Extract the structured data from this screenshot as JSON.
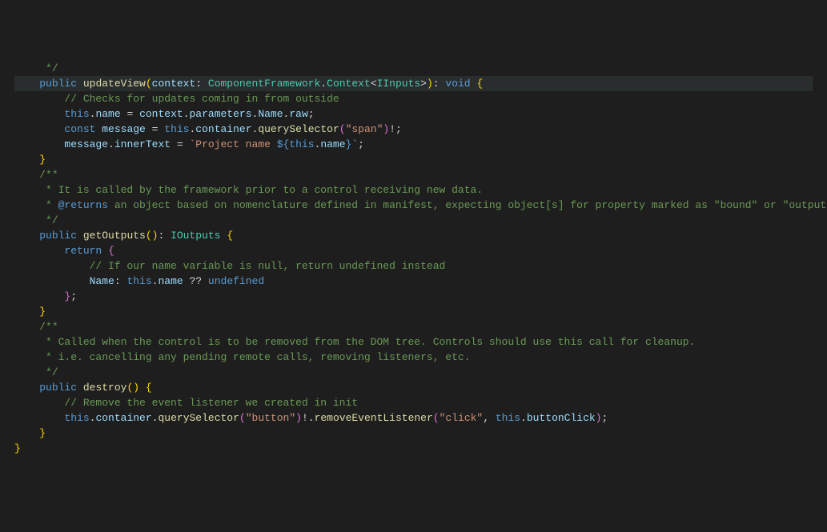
{
  "chart_data": null,
  "code": {
    "lines": [
      {
        "indent": 1,
        "tokens": [
          {
            "t": " ",
            "c": "pun"
          },
          {
            "t": "*/",
            "c": "cmt"
          }
        ]
      },
      {
        "indent": 1,
        "hl": true,
        "tokens": [
          {
            "t": "public",
            "c": "kw"
          },
          {
            "t": " ",
            "c": "pun"
          },
          {
            "t": "updateView",
            "c": "fn"
          },
          {
            "t": "(",
            "c": "brc-y"
          },
          {
            "t": "context",
            "c": "var"
          },
          {
            "t": ": ",
            "c": "pun"
          },
          {
            "t": "ComponentFramework",
            "c": "typ"
          },
          {
            "t": ".",
            "c": "pun"
          },
          {
            "t": "Context",
            "c": "typ"
          },
          {
            "t": "<",
            "c": "pun"
          },
          {
            "t": "IInputs",
            "c": "typ"
          },
          {
            "t": ">",
            "c": "pun"
          },
          {
            "t": ")",
            "c": "brc-y"
          },
          {
            "t": ": ",
            "c": "pun"
          },
          {
            "t": "void",
            "c": "kw"
          },
          {
            "t": " ",
            "c": "pun"
          },
          {
            "t": "{",
            "c": "brc-y"
          }
        ]
      },
      {
        "indent": 2,
        "tokens": [
          {
            "t": "// Checks for updates coming in from outside",
            "c": "cmt"
          }
        ]
      },
      {
        "indent": 2,
        "tokens": [
          {
            "t": "this",
            "c": "kw"
          },
          {
            "t": ".",
            "c": "pun"
          },
          {
            "t": "name",
            "c": "prop"
          },
          {
            "t": " = ",
            "c": "pun"
          },
          {
            "t": "context",
            "c": "var"
          },
          {
            "t": ".",
            "c": "pun"
          },
          {
            "t": "parameters",
            "c": "prop"
          },
          {
            "t": ".",
            "c": "pun"
          },
          {
            "t": "Name",
            "c": "prop"
          },
          {
            "t": ".",
            "c": "pun"
          },
          {
            "t": "raw",
            "c": "prop"
          },
          {
            "t": ";",
            "c": "pun"
          }
        ]
      },
      {
        "indent": 2,
        "tokens": [
          {
            "t": "const",
            "c": "kw"
          },
          {
            "t": " ",
            "c": "pun"
          },
          {
            "t": "message",
            "c": "var"
          },
          {
            "t": " = ",
            "c": "pun"
          },
          {
            "t": "this",
            "c": "kw"
          },
          {
            "t": ".",
            "c": "pun"
          },
          {
            "t": "container",
            "c": "prop"
          },
          {
            "t": ".",
            "c": "pun"
          },
          {
            "t": "querySelector",
            "c": "fn"
          },
          {
            "t": "(",
            "c": "brc-p"
          },
          {
            "t": "\"span\"",
            "c": "str"
          },
          {
            "t": ")",
            "c": "brc-p"
          },
          {
            "t": "!;",
            "c": "pun"
          }
        ]
      },
      {
        "indent": 2,
        "tokens": [
          {
            "t": "message",
            "c": "var"
          },
          {
            "t": ".",
            "c": "pun"
          },
          {
            "t": "innerText",
            "c": "prop"
          },
          {
            "t": " = ",
            "c": "pun"
          },
          {
            "t": "`Project name ",
            "c": "str"
          },
          {
            "t": "${",
            "c": "kw"
          },
          {
            "t": "this",
            "c": "kw"
          },
          {
            "t": ".",
            "c": "pun"
          },
          {
            "t": "name",
            "c": "prop"
          },
          {
            "t": "}",
            "c": "kw"
          },
          {
            "t": "`",
            "c": "str"
          },
          {
            "t": ";",
            "c": "pun"
          }
        ]
      },
      {
        "indent": 1,
        "tokens": [
          {
            "t": "}",
            "c": "brc-y"
          }
        ]
      },
      {
        "indent": 0,
        "tokens": [
          {
            "t": "",
            "c": "pun"
          }
        ]
      },
      {
        "indent": 1,
        "tokens": [
          {
            "t": "/**",
            "c": "cmt"
          }
        ]
      },
      {
        "indent": 1,
        "tokens": [
          {
            "t": " * It is called by the framework prior to a control receiving new data.",
            "c": "cmt"
          }
        ]
      },
      {
        "indent": 1,
        "tokens": [
          {
            "t": " * ",
            "c": "cmt"
          },
          {
            "t": "@returns",
            "c": "tag"
          },
          {
            "t": " an object based on nomenclature defined in manifest, expecting object[s] for property marked as \"bound\" or \"output\"",
            "c": "cmt"
          }
        ]
      },
      {
        "indent": 1,
        "tokens": [
          {
            "t": " */",
            "c": "cmt"
          }
        ]
      },
      {
        "indent": 1,
        "tokens": [
          {
            "t": "public",
            "c": "kw"
          },
          {
            "t": " ",
            "c": "pun"
          },
          {
            "t": "getOutputs",
            "c": "fn"
          },
          {
            "t": "()",
            "c": "brc-y"
          },
          {
            "t": ": ",
            "c": "pun"
          },
          {
            "t": "IOutputs",
            "c": "typ"
          },
          {
            "t": " ",
            "c": "pun"
          },
          {
            "t": "{",
            "c": "brc-y"
          }
        ]
      },
      {
        "indent": 2,
        "tokens": [
          {
            "t": "return",
            "c": "kw"
          },
          {
            "t": " ",
            "c": "pun"
          },
          {
            "t": "{",
            "c": "brc-p"
          }
        ]
      },
      {
        "indent": 3,
        "tokens": [
          {
            "t": "// If our name variable is null, return undefined instead",
            "c": "cmt"
          }
        ]
      },
      {
        "indent": 3,
        "tokens": [
          {
            "t": "Name",
            "c": "prop"
          },
          {
            "t": ": ",
            "c": "pun"
          },
          {
            "t": "this",
            "c": "kw"
          },
          {
            "t": ".",
            "c": "pun"
          },
          {
            "t": "name",
            "c": "prop"
          },
          {
            "t": " ?? ",
            "c": "pun"
          },
          {
            "t": "undefined",
            "c": "kw"
          }
        ]
      },
      {
        "indent": 2,
        "tokens": [
          {
            "t": "}",
            "c": "brc-p"
          },
          {
            "t": ";",
            "c": "pun"
          }
        ]
      },
      {
        "indent": 1,
        "tokens": [
          {
            "t": "}",
            "c": "brc-y"
          }
        ]
      },
      {
        "indent": 0,
        "tokens": [
          {
            "t": "",
            "c": "pun"
          }
        ]
      },
      {
        "indent": 1,
        "tokens": [
          {
            "t": "/**",
            "c": "cmt"
          }
        ]
      },
      {
        "indent": 1,
        "tokens": [
          {
            "t": " * Called when the control is to be removed from the DOM tree. Controls should use this call for cleanup.",
            "c": "cmt"
          }
        ]
      },
      {
        "indent": 1,
        "tokens": [
          {
            "t": " * i.e. cancelling any pending remote calls, removing listeners, etc.",
            "c": "cmt"
          }
        ]
      },
      {
        "indent": 1,
        "tokens": [
          {
            "t": " */",
            "c": "cmt"
          }
        ]
      },
      {
        "indent": 1,
        "tokens": [
          {
            "t": "public",
            "c": "kw"
          },
          {
            "t": " ",
            "c": "pun"
          },
          {
            "t": "destroy",
            "c": "fn"
          },
          {
            "t": "()",
            "c": "brc-y"
          },
          {
            "t": " ",
            "c": "pun"
          },
          {
            "t": "{",
            "c": "brc-y"
          }
        ]
      },
      {
        "indent": 2,
        "tokens": [
          {
            "t": "// Remove the event listener we created in init",
            "c": "cmt"
          }
        ]
      },
      {
        "indent": 2,
        "tokens": [
          {
            "t": "this",
            "c": "kw"
          },
          {
            "t": ".",
            "c": "pun"
          },
          {
            "t": "container",
            "c": "prop"
          },
          {
            "t": ".",
            "c": "pun"
          },
          {
            "t": "querySelector",
            "c": "fn"
          },
          {
            "t": "(",
            "c": "brc-p"
          },
          {
            "t": "\"button\"",
            "c": "str"
          },
          {
            "t": ")",
            "c": "brc-p"
          },
          {
            "t": "!.",
            "c": "pun"
          },
          {
            "t": "removeEventListener",
            "c": "fn"
          },
          {
            "t": "(",
            "c": "brc-p"
          },
          {
            "t": "\"click\"",
            "c": "str"
          },
          {
            "t": ", ",
            "c": "pun"
          },
          {
            "t": "this",
            "c": "kw"
          },
          {
            "t": ".",
            "c": "pun"
          },
          {
            "t": "buttonClick",
            "c": "prop"
          },
          {
            "t": ")",
            "c": "brc-p"
          },
          {
            "t": ";",
            "c": "pun"
          }
        ]
      },
      {
        "indent": 1,
        "tokens": [
          {
            "t": "}",
            "c": "brc-y"
          }
        ]
      },
      {
        "indent": 0,
        "tokens": [
          {
            "t": "}",
            "c": "brc-y"
          }
        ]
      }
    ]
  }
}
